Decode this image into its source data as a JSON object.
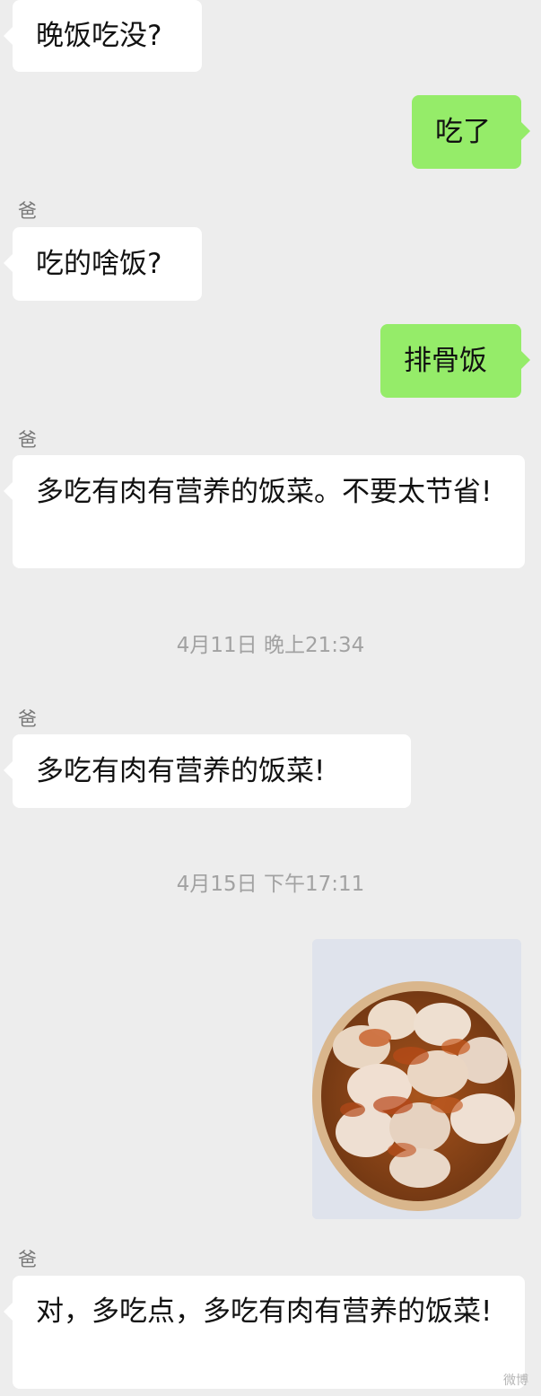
{
  "messages": [
    {
      "text": "晚饭吃没?"
    },
    {
      "text": "吃了"
    },
    {
      "sender": "爸",
      "text": "吃的啥饭?"
    },
    {
      "text": "排骨饭"
    },
    {
      "sender": "爸",
      "text": "多吃有肉有营养的饭菜。不要太节省!"
    },
    {
      "sender": "爸",
      "text": "多吃有肉有营养的饭菜!"
    },
    {
      "sender": "爸",
      "text": "对，多吃点，多吃有肉有营养的饭菜!"
    }
  ],
  "timestamps": [
    "4月11日 晚上21:34",
    "4月15日 下午17:11"
  ],
  "image": {
    "icon": "dumplings-photo"
  },
  "watermark": "微博",
  "colors": {
    "background": "#ededed",
    "incoming": "#ffffff",
    "outgoing": "#95ec69",
    "meta": "#a2a2a2"
  }
}
